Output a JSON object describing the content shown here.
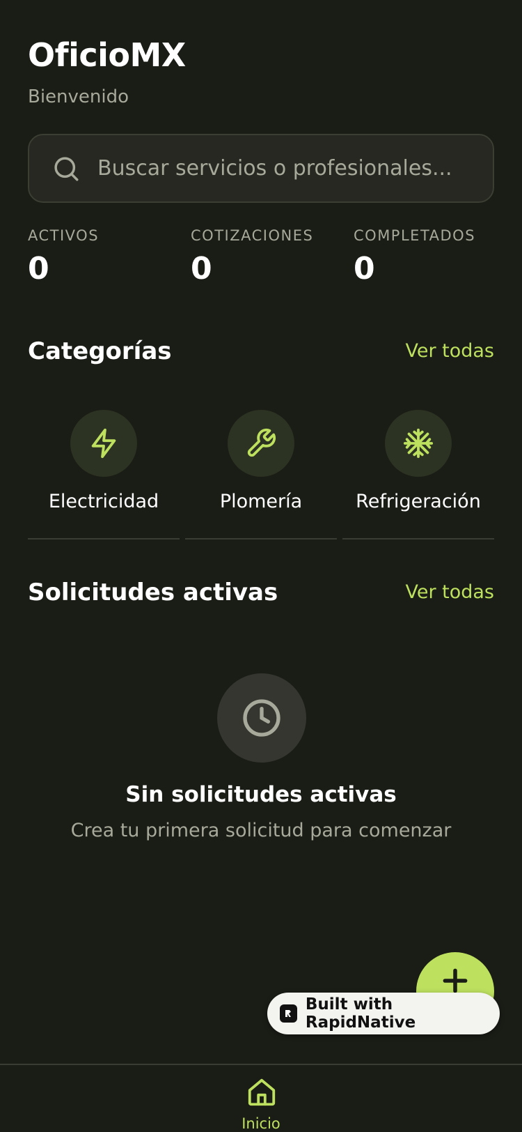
{
  "header": {
    "title": "OficioMX",
    "subtitle": "Bienvenido"
  },
  "search": {
    "placeholder": "Buscar servicios o profesionales...",
    "icon": "search-icon"
  },
  "stats": [
    {
      "label": "ACTIVOS",
      "value": "0"
    },
    {
      "label": "COTIZACIONES",
      "value": "0"
    },
    {
      "label": "COMPLETADOS",
      "value": "0"
    }
  ],
  "categories_section": {
    "title": "Categorías",
    "see_all": "Ver todas"
  },
  "categories": [
    {
      "label": "Electricidad",
      "icon": "lightning-icon"
    },
    {
      "label": "Plomería",
      "icon": "wrench-icon"
    },
    {
      "label": "Refrigeración",
      "icon": "snowflake-icon"
    }
  ],
  "requests_section": {
    "title": "Solicitudes activas",
    "see_all": "Ver todas"
  },
  "empty_state": {
    "icon": "clock-icon",
    "title": "Sin solicitudes activas",
    "subtitle": "Crea tu primera solicitud para comenzar"
  },
  "fab": {
    "icon": "plus-icon"
  },
  "badge": {
    "text": "Built with RapidNative"
  },
  "tabbar": {
    "items": [
      {
        "label": "Inicio",
        "icon": "home-icon",
        "active": true
      }
    ]
  },
  "colors": {
    "background": "#1a1c16",
    "accent": "#bde05f",
    "muted_text": "#a7a99a",
    "surface": "#262821"
  }
}
